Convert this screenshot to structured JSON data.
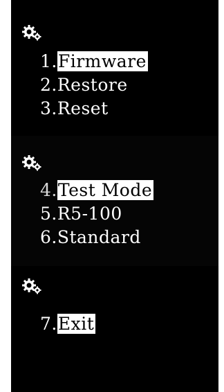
{
  "sections": [
    {
      "icon": "gear-icon",
      "items": [
        {
          "number": "1.",
          "label": "Firmware",
          "highlighted": true
        },
        {
          "number": "2.",
          "label": "Restore",
          "highlighted": false
        },
        {
          "number": "3.",
          "label": "Reset",
          "highlighted": false
        }
      ]
    },
    {
      "icon": "gear-icon",
      "items": [
        {
          "number": "4.",
          "label": "Test Mode",
          "highlighted": true
        },
        {
          "number": "5.",
          "label": "R5-100",
          "highlighted": false
        },
        {
          "number": "6.",
          "label": "Standard",
          "highlighted": false
        }
      ]
    },
    {
      "icon": "gear-icon",
      "items": [
        {
          "number": "7.",
          "label": "Exit",
          "highlighted": true
        }
      ]
    }
  ],
  "colors": {
    "background": "#000000",
    "text": "#ffffff",
    "highlight_bg": "#ffffff",
    "highlight_text": "#000000",
    "page_border": "#ffffff"
  }
}
